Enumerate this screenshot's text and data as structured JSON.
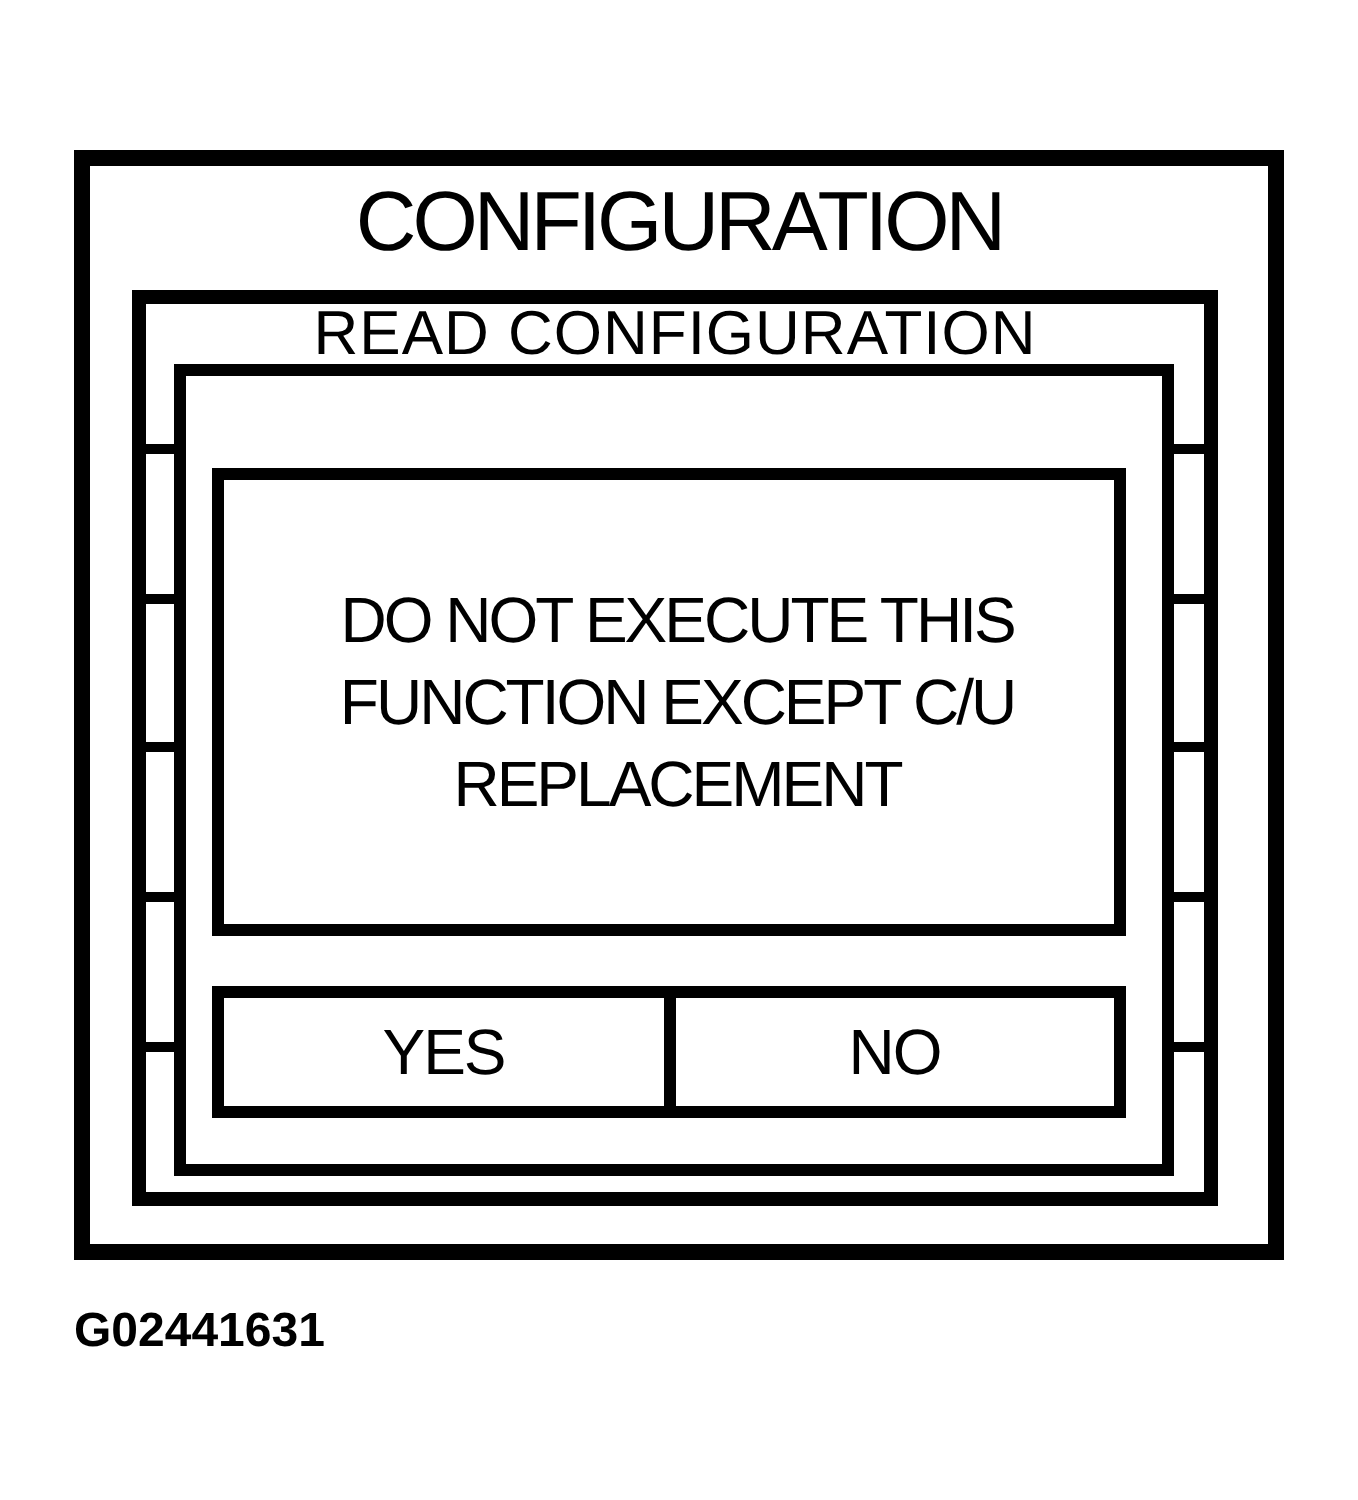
{
  "screen": {
    "title": "CONFIGURATION"
  },
  "menu": {
    "items": [
      {
        "label": "READ CONFIGURATION"
      }
    ]
  },
  "dialog": {
    "message": "DO NOT EXECUTE THIS\nFUNCTION EXCEPT C/U\nREPLACEMENT",
    "buttons": [
      {
        "label": "YES"
      },
      {
        "label": "NO"
      }
    ]
  },
  "figure_code": "G02441631"
}
